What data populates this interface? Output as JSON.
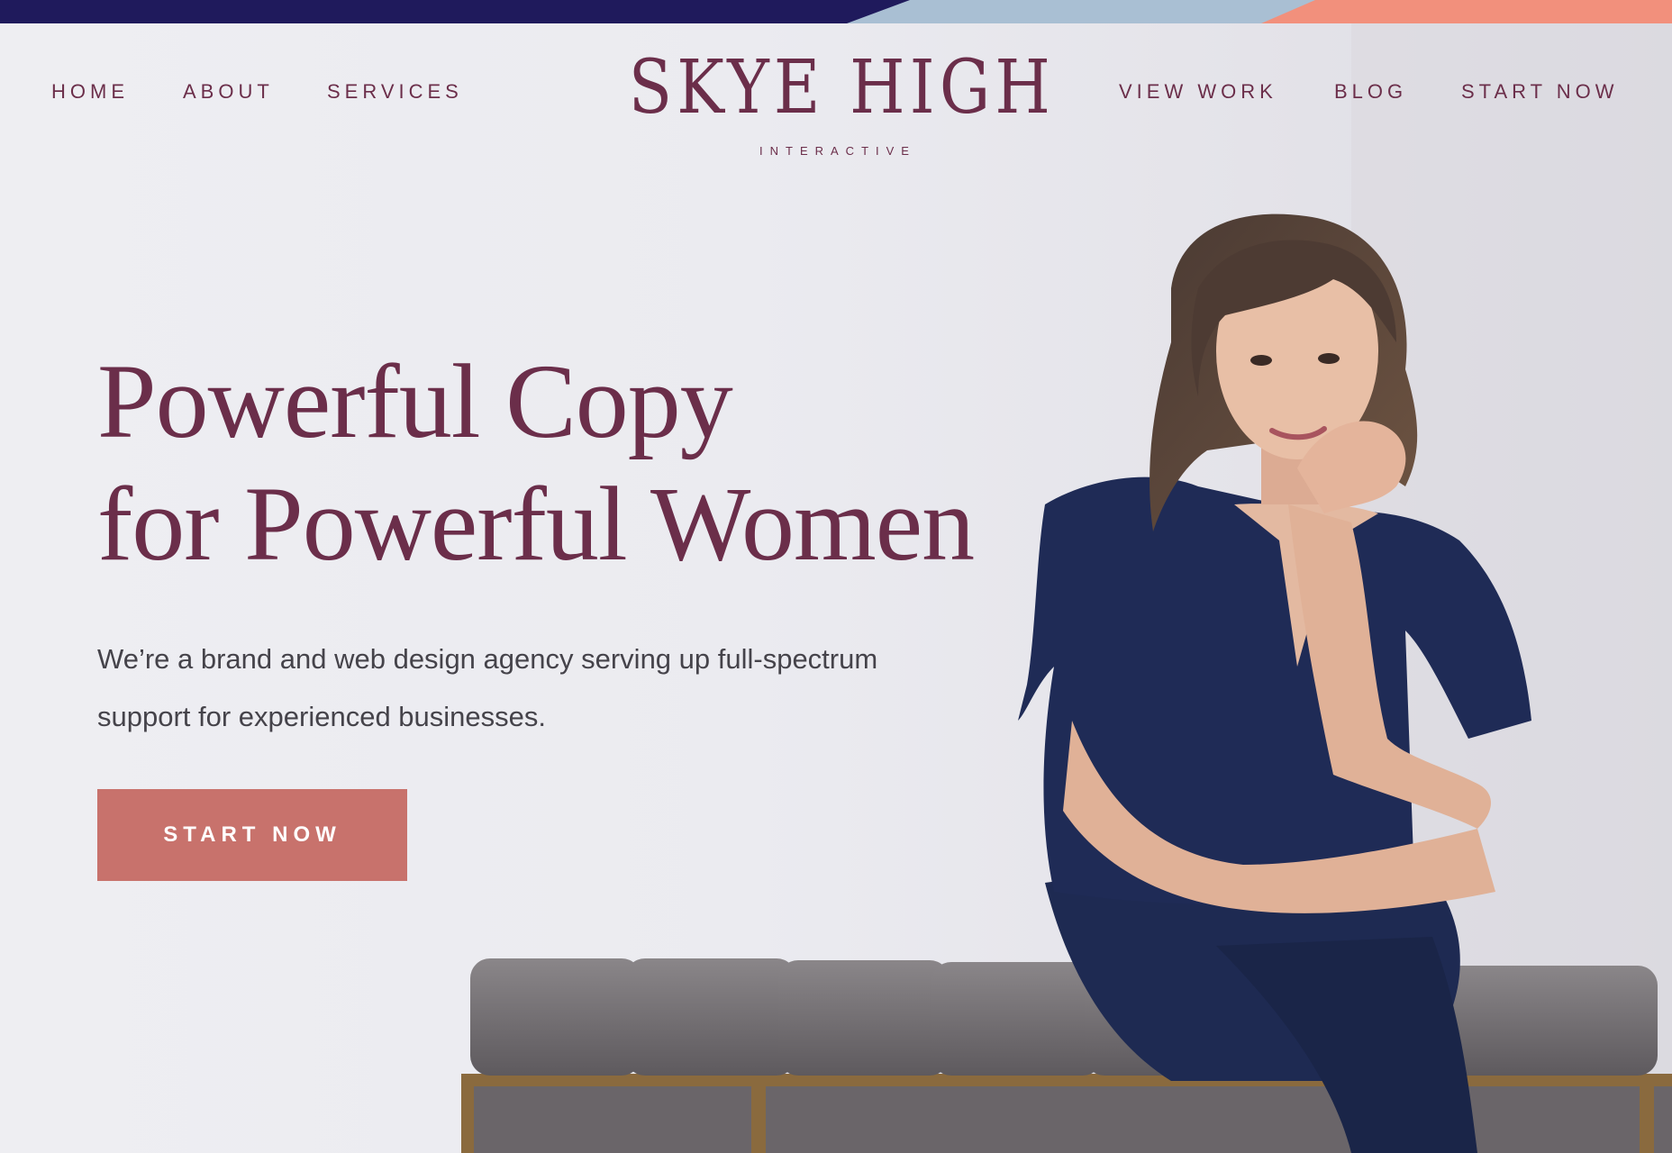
{
  "site": {
    "logo": {
      "title": "SKYE HIGH",
      "subtitle": "INTERACTIVE"
    },
    "nav_left": [
      {
        "label": "HOME"
      },
      {
        "label": "ABOUT"
      },
      {
        "label": "SERVICES"
      }
    ],
    "nav_right": [
      {
        "label": "VIEW WORK"
      },
      {
        "label": "BLOG"
      },
      {
        "label": "START NOW"
      }
    ]
  },
  "hero": {
    "headline_line1": "Powerful Copy",
    "headline_line2": "for Powerful Women",
    "subcopy_line1": "We’re a brand and web design agency serving up full-spectrum",
    "subcopy_line2": "support for experienced businesses.",
    "cta_label": "START NOW",
    "photo": "woman-seated-on-upholstered-bench"
  },
  "colors": {
    "brand_plum": "#6b2e4a",
    "cta_rose": "#c8726c",
    "strip_navy": "#1f1a5c",
    "strip_blue": "#a9bfd3",
    "strip_coral": "#f2907c",
    "body_text": "#45434a"
  }
}
